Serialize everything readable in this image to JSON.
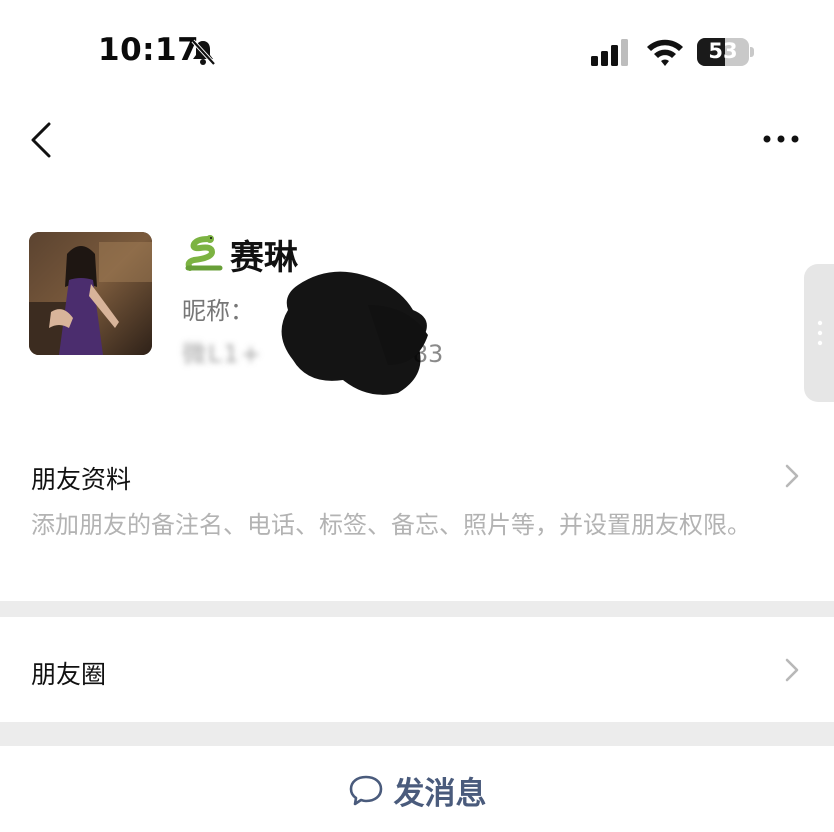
{
  "status_bar": {
    "time": "10:17",
    "battery_level": "53",
    "battery_fraction": 0.53,
    "icons": [
      "bell-muted-icon",
      "signal-icon",
      "wifi-icon",
      "battery-icon"
    ]
  },
  "nav": {
    "back_icon": "chevron-left-icon",
    "more_icon": "more-dots-icon"
  },
  "profile": {
    "name": "赛琳",
    "name_emoji": "snake-icon",
    "nickname_label": "昵称：",
    "wechat_id_prefix": "微",
    "wechat_id_suffix": "83"
  },
  "rows": {
    "friend_info": {
      "title": "朋友资料",
      "description": "添加朋友的备注名、电话、标签、备忘、照片等，并设置朋友权限。"
    },
    "moments": {
      "title": "朋友圈"
    }
  },
  "actions": {
    "send_message": "发消息"
  },
  "colors": {
    "background": "#ffffff",
    "section_divider": "#ececec",
    "link_text": "#4a5b7c",
    "secondary_text": "#b3b3b3"
  }
}
